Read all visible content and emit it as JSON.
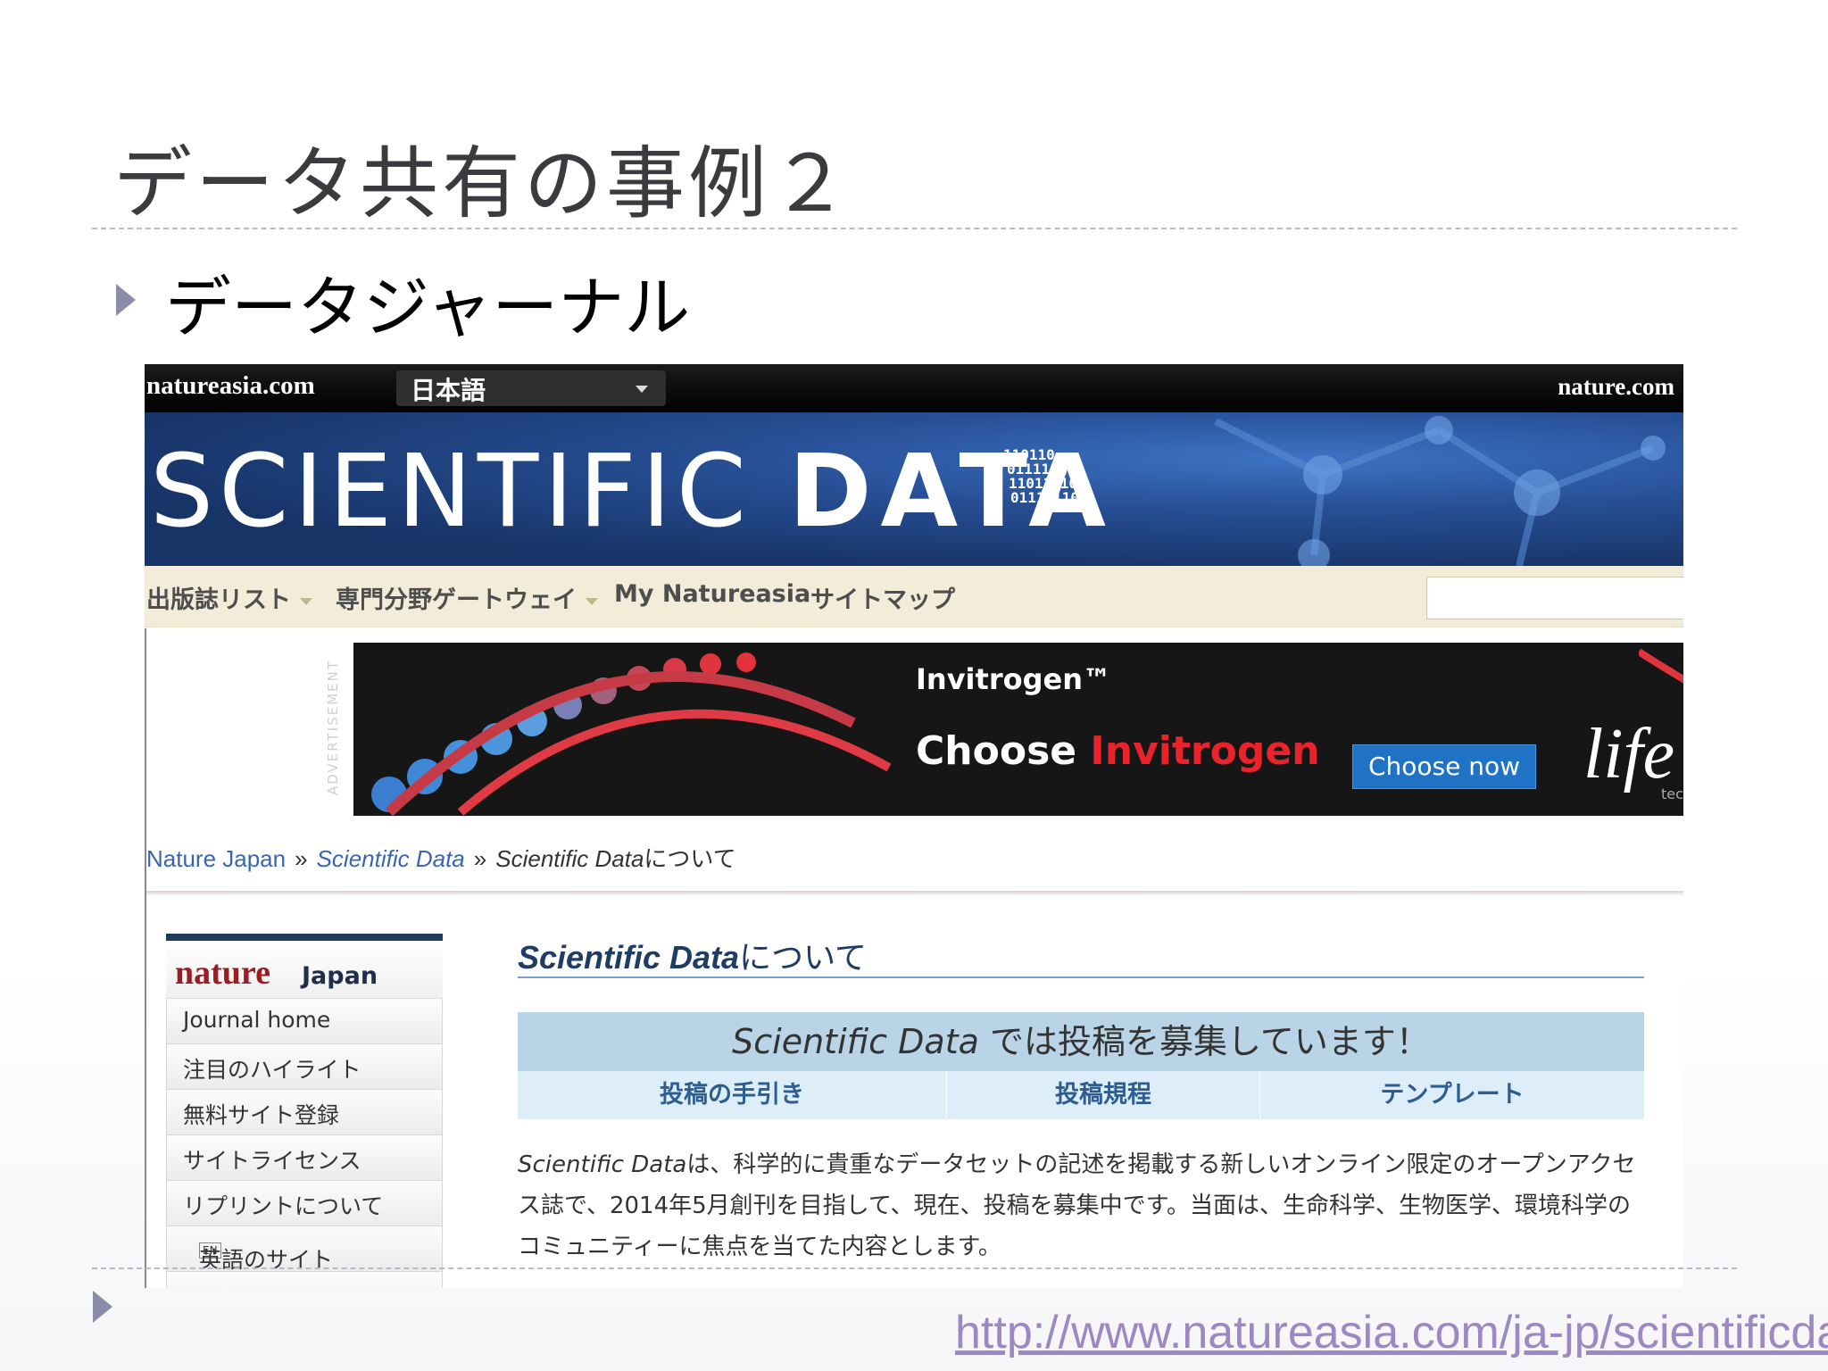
{
  "slide": {
    "title": "データ共有の事例２",
    "bullet": "データジャーナル",
    "url": "http://www.natureasia.com/ja-jp/scientificda"
  },
  "screenshot": {
    "topbar": {
      "site": "natureasia.com",
      "language": "日本語",
      "right_link": "nature.com"
    },
    "banner": {
      "logo_light": "SCIENTIFIC ",
      "logo_bold": "DATA",
      "binary": [
        "110110",
        "0111101",
        "11011110",
        "011101101"
      ]
    },
    "nav": {
      "items": [
        "出版誌リスト",
        "専門分野ゲートウェイ",
        "My Natureasia",
        "サイトマップ"
      ]
    },
    "ad": {
      "side_label": "ADVERTISEMENT",
      "brand": "Invitrogen™",
      "tag_prefix": "Choose ",
      "tag_red": "Invitrogen",
      "button": "Choose now",
      "logo": "life",
      "logo_sub": "tech"
    },
    "breadcrumb": {
      "home": "Nature Japan",
      "sep": "»",
      "section": "Scientific Data",
      "current_italic": "Scientific Data",
      "current_rest": "について"
    },
    "sidebar": {
      "brand_nature": "nature",
      "brand_japan": "Japan",
      "items": [
        "Journal home",
        "注目のハイライト",
        "無料サイト登録",
        "サイトライセンス",
        "リプリントについて"
      ],
      "en_badge": "EN",
      "english_site": "英語のサイト"
    },
    "content": {
      "heading_italic": "Scientific Data",
      "heading_rest": "について",
      "call_italic": "Scientific Data",
      "call_rest": " では投稿を募集しています！",
      "links": [
        "投稿の手引き",
        "投稿規程",
        "テンプレート"
      ],
      "desc_italic": "Scientific Data",
      "desc_rest": "は、科学的に貴重なデータセットの記述を掲載する新しいオンライン限定のオープンアクセス誌で、2014年5月創刊を目指して、現在、投稿を募集中です。当面は、生命科学、生物医学、環境科学のコミュニティーに焦点を当てた内容とします。"
    }
  }
}
